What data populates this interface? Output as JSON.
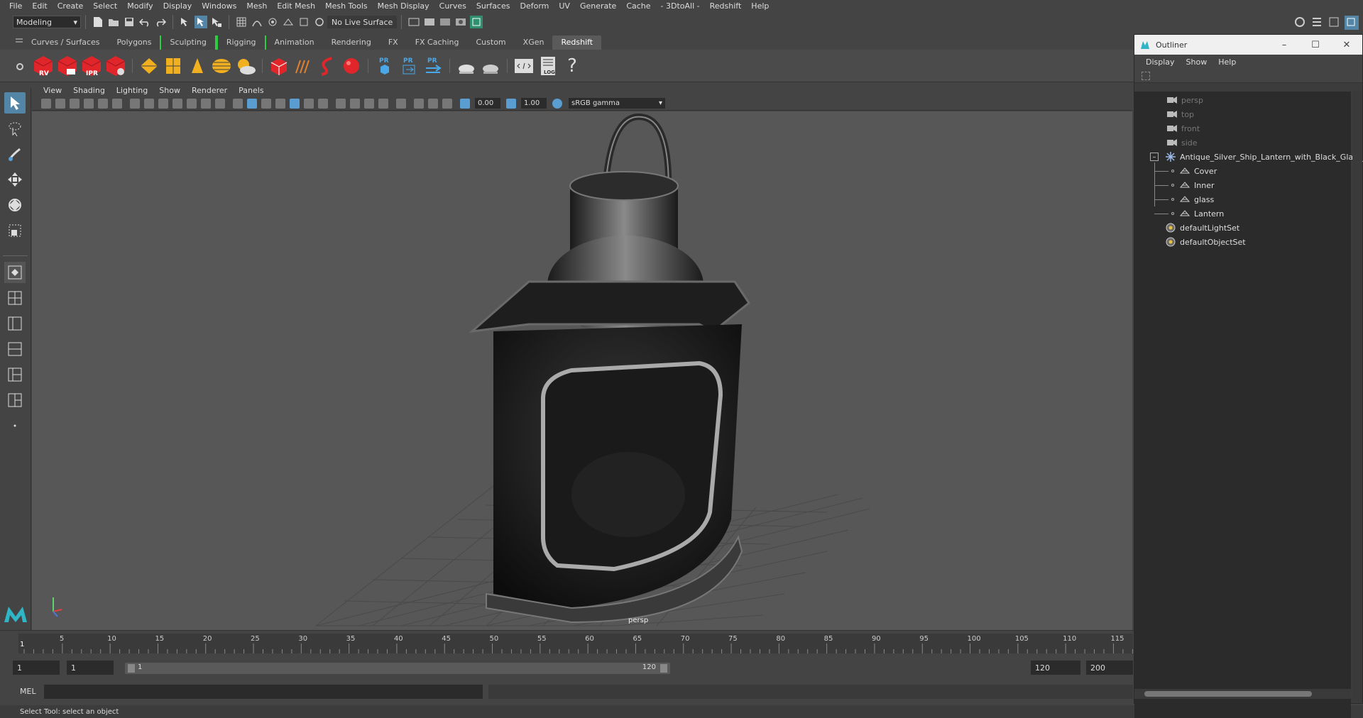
{
  "menubar": [
    "File",
    "Edit",
    "Create",
    "Select",
    "Modify",
    "Display",
    "Windows",
    "Mesh",
    "Edit Mesh",
    "Mesh Tools",
    "Mesh Display",
    "Curves",
    "Surfaces",
    "Deform",
    "UV",
    "Generate",
    "Cache",
    "- 3DtoAll -",
    "Redshift",
    "Help"
  ],
  "statusline": {
    "mode": "Modeling",
    "live_surface": "No Live Surface"
  },
  "shelf_tabs": [
    "Curves / Surfaces",
    "Polygons",
    "Sculpting",
    "Rigging",
    "Animation",
    "Rendering",
    "FX",
    "FX Caching",
    "Custom",
    "XGen",
    "Redshift"
  ],
  "active_shelf": "Redshift",
  "shelf_icon_labels": {
    "rv": "RV",
    "ipr": "IPR",
    "pr": "PR",
    "log": "LOG",
    "help": "?"
  },
  "viewport": {
    "menu": [
      "View",
      "Shading",
      "Lighting",
      "Show",
      "Renderer",
      "Panels"
    ],
    "exposure": "0.00",
    "gamma": "1.00",
    "color_space": "sRGB gamma",
    "camera_label": "persp"
  },
  "timeline": {
    "ticks": [
      "5",
      "10",
      "15",
      "20",
      "25",
      "30",
      "35",
      "40",
      "45",
      "50",
      "55",
      "60",
      "65",
      "70",
      "75",
      "80",
      "85",
      "90",
      "95",
      "100",
      "105",
      "110",
      "115"
    ],
    "current_frame": "1"
  },
  "range": {
    "start": "1",
    "current": "1",
    "slider_start": "1",
    "slider_end": "120",
    "end": "120",
    "max": "200"
  },
  "mel_label": "MEL",
  "status_text": "Select Tool: select an object",
  "outliner": {
    "title": "Outliner",
    "menu": [
      "Display",
      "Show",
      "Help"
    ],
    "cameras": [
      "persp",
      "top",
      "front",
      "side"
    ],
    "group": "Antique_Silver_Ship_Lantern_with_Black_Glass_C",
    "children": [
      "Cover",
      "Inner",
      "glass",
      "Lantern"
    ],
    "sets": [
      "defaultLightSet",
      "defaultObjectSet"
    ]
  },
  "colors": {
    "accent": "#5285a6",
    "maya_teal": "#2fb5c5",
    "redshift_red": "#e0262b"
  }
}
